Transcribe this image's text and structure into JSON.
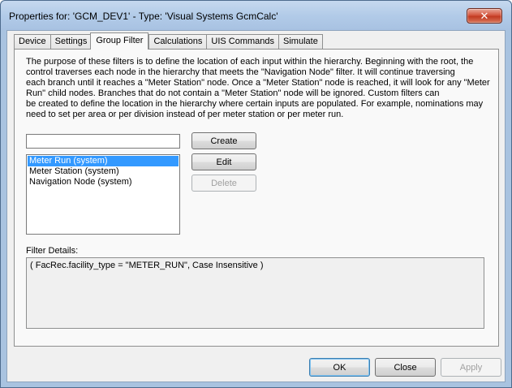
{
  "window": {
    "title": "Properties for: 'GCM_DEV1' - Type: 'Visual Systems GcmCalc'",
    "close_glyph": "✕"
  },
  "tabs": [
    {
      "label": "Device"
    },
    {
      "label": "Settings"
    },
    {
      "label": "Group Filter",
      "active": true
    },
    {
      "label": "Calculations"
    },
    {
      "label": "UIS Commands"
    },
    {
      "label": "Simulate"
    }
  ],
  "description_lines": [
    "The purpose of these filters is to define the location of each input within the hierarchy. Beginning with the root, the",
    "control traverses each node in the hierarchy that meets the \"Navigation Node\" filter. It will continue traversing",
    "each branch until it reaches a \"Meter Station\" node. Once a \"Meter Station\" node is reached, it will look for any \"Meter",
    "Run\" child nodes. Branches that do not contain a \"Meter Station\" node will be ignored.  Custom filters can",
    "be created to define the location in the hierarchy where certain inputs are populated. For example, nominations may",
    "need to set per area or per division instead of per meter station or per meter run."
  ],
  "filter_name_input": {
    "value": ""
  },
  "filters": [
    {
      "label": "Meter Run (system)",
      "selected": true
    },
    {
      "label": "Meter Station (system)",
      "selected": false
    },
    {
      "label": "Navigation Node (system)",
      "selected": false
    }
  ],
  "buttons": {
    "create": "Create",
    "edit": "Edit",
    "delete": "Delete"
  },
  "filter_details": {
    "label": "Filter Details:",
    "text": "( FacRec.facility_type = \"METER_RUN\", Case Insensitive )"
  },
  "footer": {
    "ok": "OK",
    "close": "Close",
    "apply": "Apply"
  }
}
